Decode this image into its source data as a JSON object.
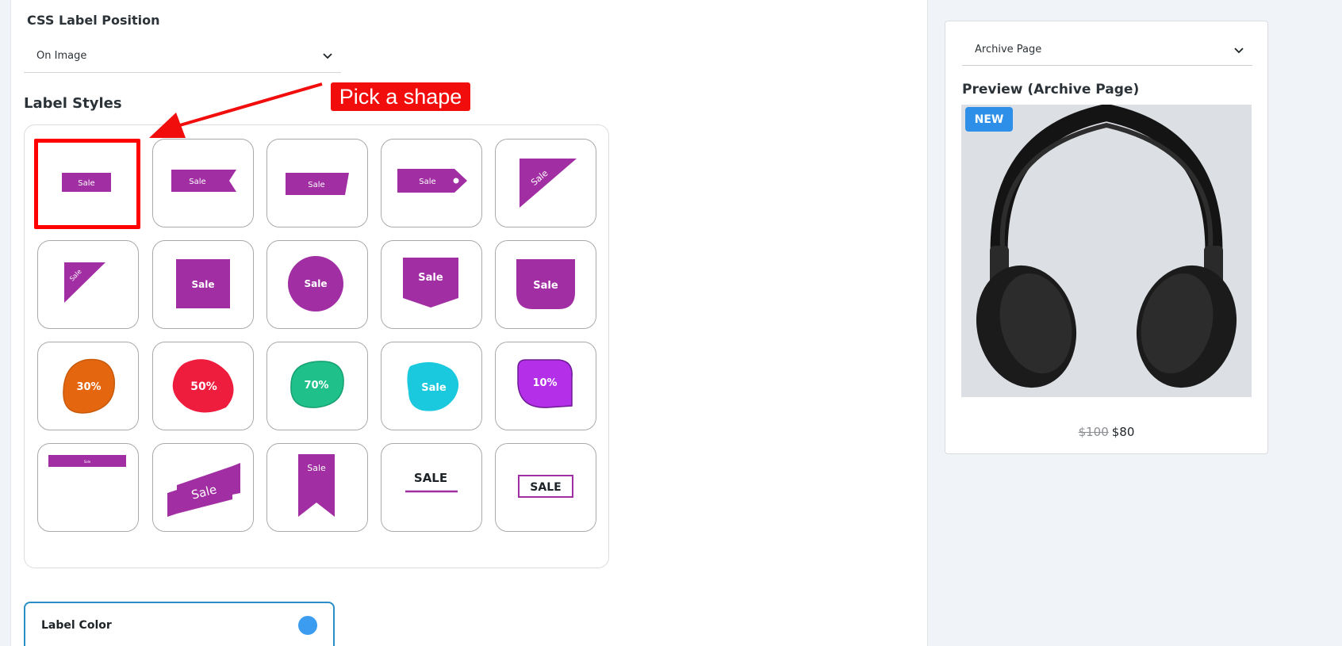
{
  "position": {
    "title": "CSS Label Position",
    "selected": "On Image"
  },
  "styles": {
    "title": "Label Styles"
  },
  "annotation": {
    "text": "Pick a shape"
  },
  "cells": [
    {
      "text": "Sale"
    },
    {
      "text": "Sale"
    },
    {
      "text": "Sale"
    },
    {
      "text": "Sale"
    },
    {
      "text": "Sale"
    },
    {
      "text": "Sale"
    },
    {
      "text": "Sale"
    },
    {
      "text": "Sale"
    },
    {
      "text": "Sale"
    },
    {
      "text": "Sale"
    },
    {
      "text": "30%"
    },
    {
      "text": "50%"
    },
    {
      "text": "70%"
    },
    {
      "text": "Sale"
    },
    {
      "text": "10%"
    },
    {
      "text": "Sale"
    },
    {
      "text": "Sale"
    },
    {
      "text": "Sale"
    },
    {
      "text": "SALE"
    },
    {
      "text": "SALE"
    }
  ],
  "color": {
    "label": "Label Color",
    "value": "#3b9cf0"
  },
  "preview": {
    "page_select": "Archive Page",
    "title": "Preview (Archive Page)",
    "badge": "NEW",
    "old_price": "$100",
    "new_price": "$80"
  },
  "colors": {
    "purple": "#a12fa3",
    "red_annotation": "#f20d0d",
    "badge_blue": "#2d8fe8"
  }
}
